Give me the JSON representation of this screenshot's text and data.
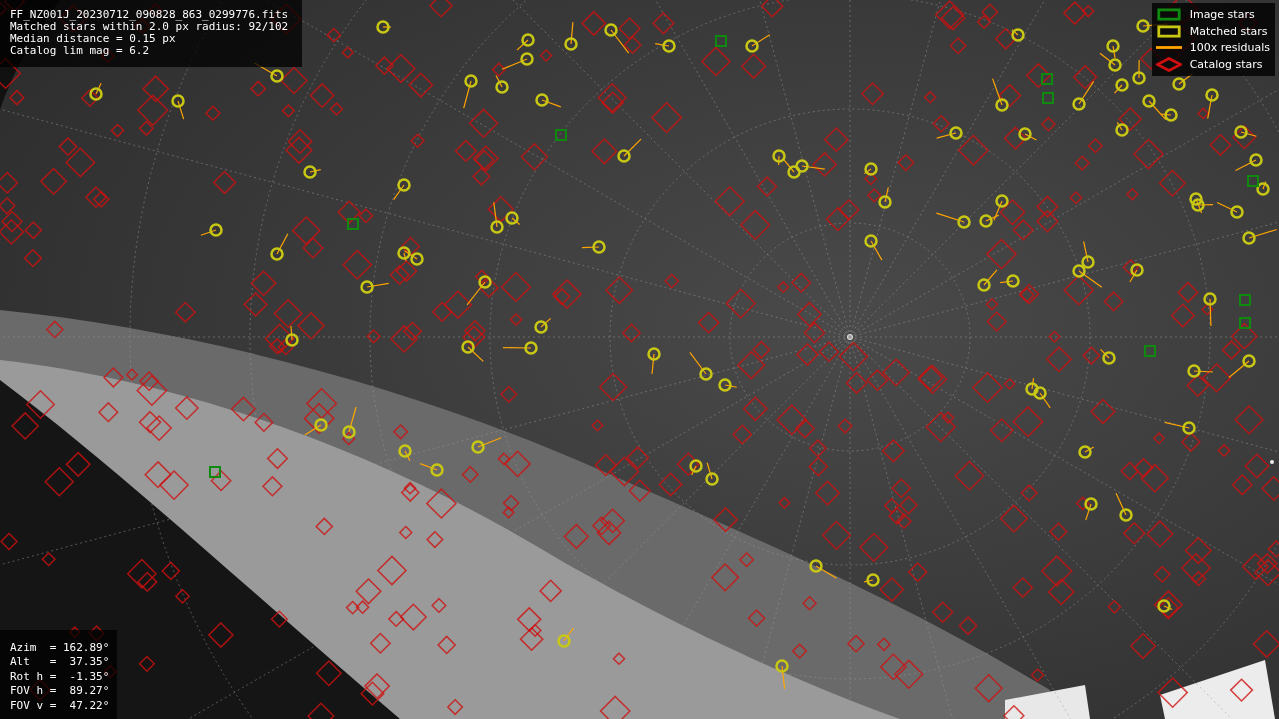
{
  "info_panel": {
    "lines": [
      "FF_NZ001J_20230712_090828_863_0299776.fits",
      "Matched stars within 2.0 px radius: 92/102",
      "Median distance = 0.15 px",
      "Catalog lim mag = 6.2"
    ]
  },
  "legend": [
    {
      "label": "Image stars",
      "color": "#0f8a0f"
    },
    {
      "kind": "matched",
      "label": "Matched stars",
      "color": "#c8c814"
    },
    {
      "kind": "residual",
      "label": "100x residuals",
      "color": "#ffa500"
    },
    {
      "kind": "catalog",
      "label": "Catalog stars",
      "color": "#d01010"
    }
  ],
  "pointing_panel": {
    "lines": [
      "Azim  = 162.89°",
      "Alt   =  37.35°",
      "Rot h =  -1.35°",
      "FOV h =  89.27°",
      "FOV v =  47.22°"
    ]
  }
}
